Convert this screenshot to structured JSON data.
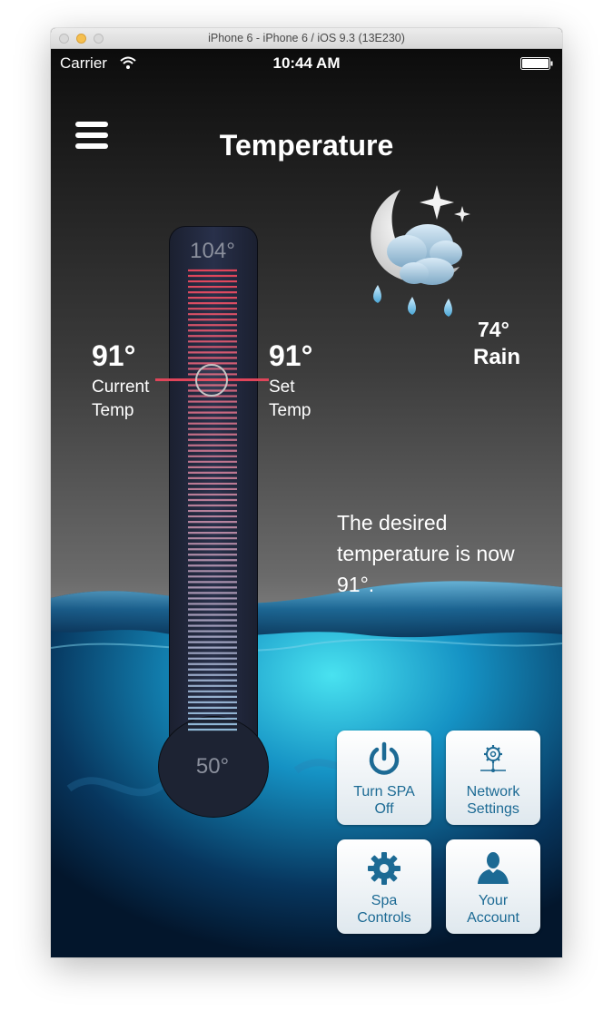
{
  "window": {
    "title": "iPhone 6 - iPhone 6 / iOS 9.3 (13E230)"
  },
  "status_bar": {
    "carrier": "Carrier",
    "time": "10:44 AM"
  },
  "header": {
    "title": "Temperature"
  },
  "weather": {
    "temp": "74°",
    "condition": "Rain",
    "icon": "moon-cloud-rain-icon"
  },
  "thermometer": {
    "max_label": "104°",
    "min_label": "50°",
    "max_value": 104,
    "min_value": 50,
    "set_value": 91
  },
  "current": {
    "value": "91°",
    "label_line1": "Current",
    "label_line2": "Temp"
  },
  "set": {
    "value": "91°",
    "label_line1": "Set",
    "label_line2": "Temp"
  },
  "message": "The desired temperature is now 91°.",
  "tiles": [
    {
      "line1": "Turn SPA",
      "line2": "Off",
      "icon": "power-icon"
    },
    {
      "line1": "Network",
      "line2": "Settings",
      "icon": "network-gear-icon"
    },
    {
      "line1": "Spa",
      "line2": "Controls",
      "icon": "gear-icon"
    },
    {
      "line1": "Your",
      "line2": "Account",
      "icon": "user-icon"
    }
  ],
  "colors": {
    "accent": "#1c6a94",
    "set_line": "#e0455a",
    "hot": "#e0455a",
    "cold": "#8fb7d6"
  }
}
